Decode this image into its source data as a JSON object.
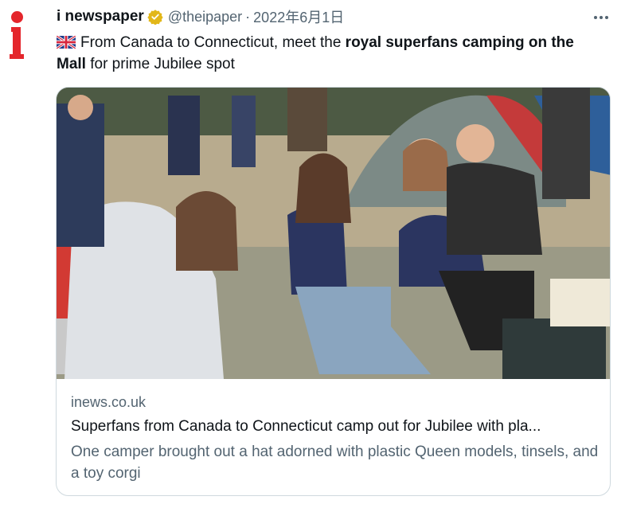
{
  "tweet": {
    "author": {
      "display_name": "i newspaper",
      "handle": "@theipaper",
      "verified": true,
      "avatar_icon": "i-newspaper-logo",
      "brand_color": "#e4262c"
    },
    "separator": "·",
    "date": "2022年6月1日",
    "more_icon": "more-dots-icon",
    "text": {
      "flag_icon": "uk-flag-emoji",
      "part1": "From Canada to Connecticut, meet the ",
      "bold": "royal superfans camping on the Mall",
      "part2": " for prime Jubilee spot"
    }
  },
  "card": {
    "domain": "inews.co.uk",
    "title": "Superfans from Canada to Connecticut camp out for Jubilee with pla...",
    "description": "One camper brought out a hat adorned with plastic Queen models, tinsels, and a toy corgi",
    "image_icon": "article-photo"
  }
}
